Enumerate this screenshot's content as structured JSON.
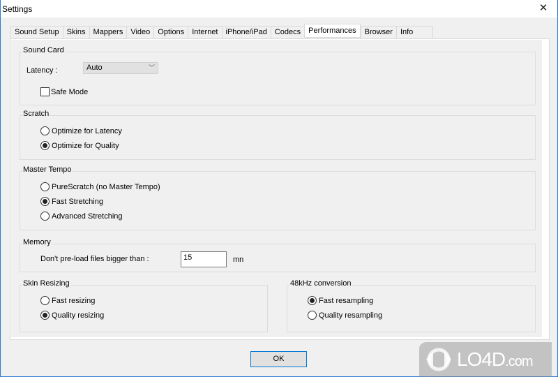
{
  "window": {
    "title": "Settings",
    "close_glyph": "✕"
  },
  "tabs": [
    {
      "label": "Sound Setup",
      "active": false
    },
    {
      "label": "Skins",
      "active": false
    },
    {
      "label": "Mappers",
      "active": false
    },
    {
      "label": "Video",
      "active": false
    },
    {
      "label": "Options",
      "active": false
    },
    {
      "label": "Internet",
      "active": false
    },
    {
      "label": "iPhone/iPad",
      "active": false
    },
    {
      "label": "Codecs",
      "active": false
    },
    {
      "label": "Performances",
      "active": true
    },
    {
      "label": "Browser",
      "active": false
    },
    {
      "label": "Info",
      "active": false
    }
  ],
  "sound_card": {
    "title": "Sound Card",
    "latency_label": "Latency :",
    "latency_value": "Auto",
    "safe_mode_label": "Safe Mode",
    "safe_mode_checked": false
  },
  "scratch": {
    "title": "Scratch",
    "options": [
      {
        "label": "Optimize for Latency",
        "selected": false
      },
      {
        "label": "Optimize for Quality",
        "selected": true
      }
    ]
  },
  "master_tempo": {
    "title": "Master Tempo",
    "options": [
      {
        "label": "PureScratch (no Master Tempo)",
        "selected": false
      },
      {
        "label": "Fast Stretching",
        "selected": true
      },
      {
        "label": "Advanced Stretching",
        "selected": false
      }
    ]
  },
  "memory": {
    "title": "Memory",
    "preload_label": "Don't pre-load files bigger than :",
    "preload_value": "15",
    "unit": "mn"
  },
  "skin_resizing": {
    "title": "Skin Resizing",
    "options": [
      {
        "label": "Fast resizing",
        "selected": false
      },
      {
        "label": "Quality resizing",
        "selected": true
      }
    ]
  },
  "conversion_48k": {
    "title": "48kHz conversion",
    "options": [
      {
        "label": "Fast resampling",
        "selected": true
      },
      {
        "label": "Quality resampling",
        "selected": false
      }
    ]
  },
  "footer": {
    "ok_label": "OK"
  },
  "watermark": {
    "text": "LO4D",
    "suffix": ".com"
  }
}
